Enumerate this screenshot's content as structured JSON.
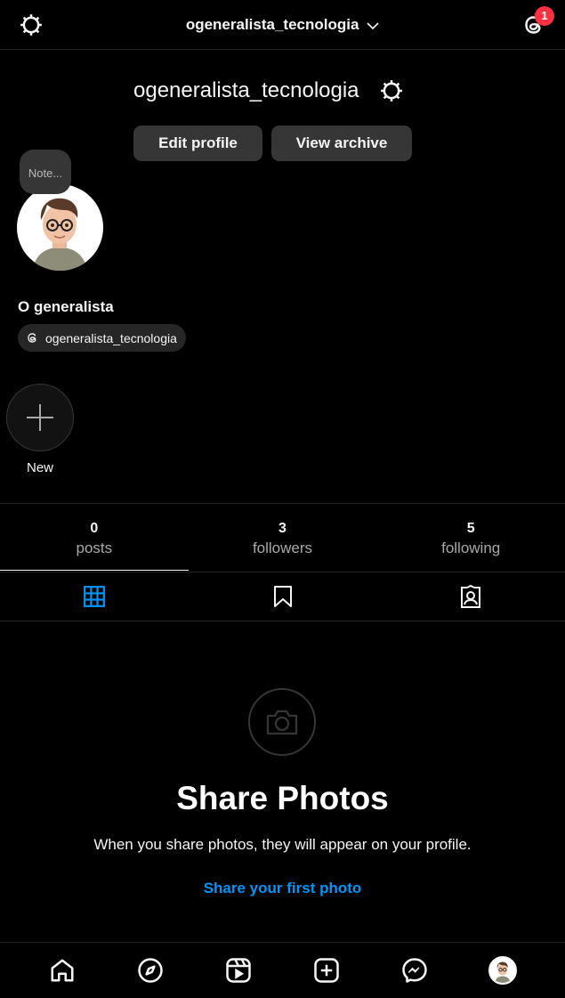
{
  "header": {
    "username": "ogeneralista_tecnologia",
    "notification_count": "1"
  },
  "profile": {
    "username": "ogeneralista_tecnologia",
    "edit_label": "Edit profile",
    "archive_label": "View archive",
    "note_label": "Note...",
    "display_name": "O generalista",
    "threads_handle": "ogeneralista_tecnologia",
    "new_highlight_label": "New"
  },
  "stats": [
    {
      "value": "0",
      "label": "posts"
    },
    {
      "value": "3",
      "label": "followers"
    },
    {
      "value": "5",
      "label": "following"
    }
  ],
  "tabs": [
    "grid-icon",
    "saved-icon",
    "tagged-icon"
  ],
  "empty_state": {
    "title": "Share Photos",
    "subtitle": "When you share photos, they will appear on your profile.",
    "link": "Share your first photo"
  },
  "nav": [
    "home-icon",
    "explore-icon",
    "reels-icon",
    "create-icon",
    "messenger-icon",
    "profile-avatar"
  ],
  "colors": {
    "accent": "#0095f6",
    "badge": "#ff3040",
    "background": "#000000"
  }
}
